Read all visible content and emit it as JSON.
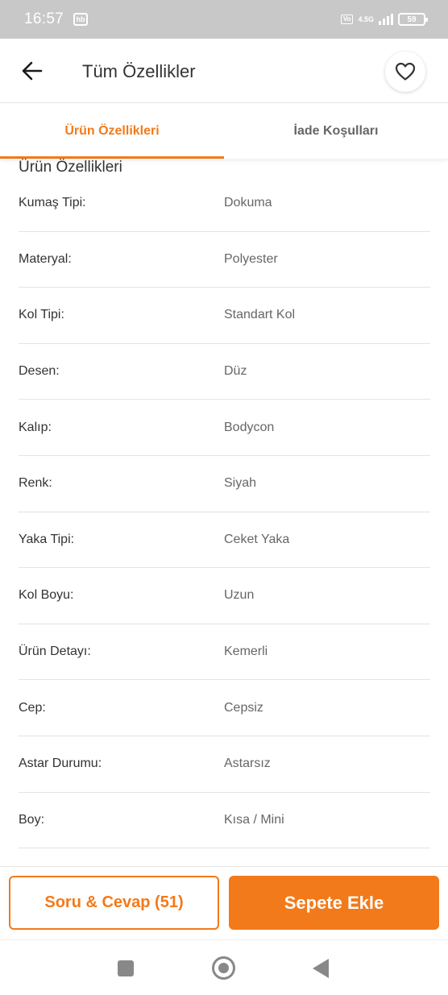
{
  "status_bar": {
    "time": "16:57",
    "app_badge": "hb",
    "volte": "VoLTE",
    "network": "4.5G",
    "battery": "59"
  },
  "header": {
    "title": "Tüm Özellikler",
    "back_icon": "arrow-left-icon",
    "favorite_icon": "heart-icon"
  },
  "tabs": [
    {
      "label": "Ürün Özellikleri",
      "active": true
    },
    {
      "label": "İade Koşulları",
      "active": false
    }
  ],
  "section": {
    "title": "Ürün Özellikleri",
    "rows": [
      {
        "key": "Kumaş Tipi:",
        "value": "Dokuma"
      },
      {
        "key": "Materyal:",
        "value": "Polyester"
      },
      {
        "key": "Kol Tipi:",
        "value": "Standart Kol"
      },
      {
        "key": "Desen:",
        "value": "Düz"
      },
      {
        "key": "Kalıp:",
        "value": "Bodycon"
      },
      {
        "key": "Renk:",
        "value": "Siyah"
      },
      {
        "key": "Yaka Tipi:",
        "value": "Ceket Yaka"
      },
      {
        "key": "Kol Boyu:",
        "value": "Uzun"
      },
      {
        "key": "Ürün Detayı:",
        "value": "Kemerli"
      },
      {
        "key": "Cep:",
        "value": "Cepsiz"
      },
      {
        "key": "Astar Durumu:",
        "value": "Astarsız"
      },
      {
        "key": "Boy:",
        "value": "Kısa / Mini"
      }
    ]
  },
  "actions": {
    "qa_label": "Soru & Cevap (51)",
    "cart_label": "Sepete Ekle"
  },
  "nav": {
    "recents_icon": "square-icon",
    "home_icon": "circle-home-icon",
    "back_icon": "triangle-back-icon"
  },
  "colors": {
    "accent": "#f27a1a",
    "status_bar": "#c8c8c8",
    "text": "#333333",
    "muted": "#666666"
  }
}
